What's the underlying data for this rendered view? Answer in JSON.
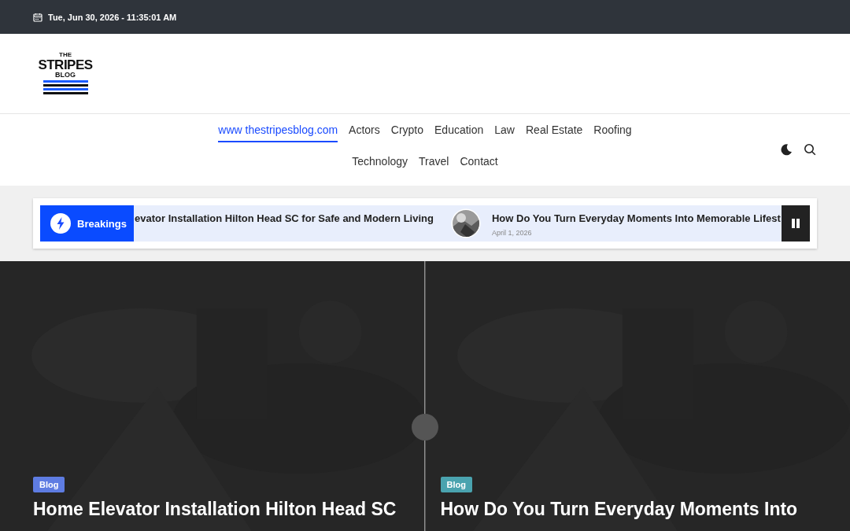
{
  "topbar": {
    "datetime": "Tue, Jun 30, 2026 - 11:35:01 AM"
  },
  "logo": {
    "lines": [
      "THE",
      "STRIPES",
      "BLOG"
    ]
  },
  "nav": {
    "items": [
      {
        "label": "www thestripesblog.com",
        "selected": true
      },
      {
        "label": "Actors",
        "selected": false
      },
      {
        "label": "Crypto",
        "selected": false
      },
      {
        "label": "Education",
        "selected": false
      },
      {
        "label": "Law",
        "selected": false
      },
      {
        "label": "Real Estate",
        "selected": false
      },
      {
        "label": "Roofing",
        "selected": false
      },
      {
        "label": "Technology",
        "selected": false
      },
      {
        "label": "Travel",
        "selected": false
      },
      {
        "label": "Contact",
        "selected": false
      }
    ]
  },
  "ticker": {
    "label": "Breakings",
    "items": [
      {
        "title": "evator Installation Hilton Head SC for Safe and Modern Living",
        "thumb": false
      },
      {
        "title": "How Do You Turn Everyday Moments Into Memorable Lifest",
        "date": "April 1, 2026",
        "thumb": true
      }
    ]
  },
  "slides": [
    {
      "tag": "Blog",
      "color": "#5e7ce2",
      "title": "Home Elevator Installation Hilton Head SC"
    },
    {
      "tag": "Blog",
      "color": "#4aa3af",
      "title": "How Do You Turn Everyday Moments Into"
    }
  ]
}
